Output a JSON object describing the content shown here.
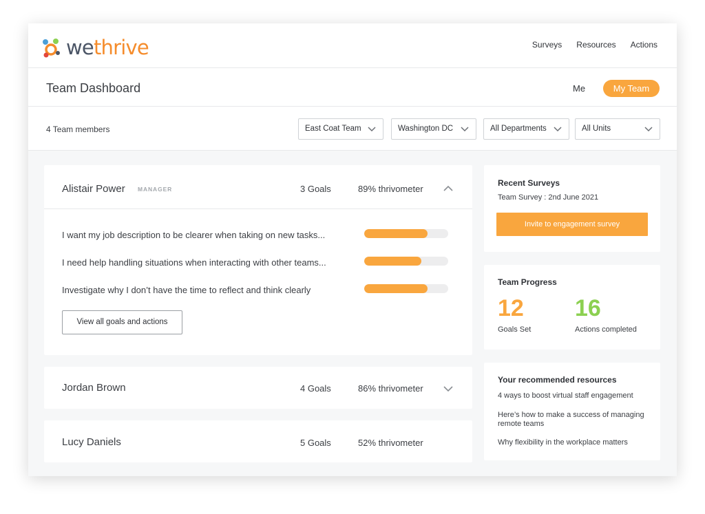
{
  "brand": {
    "name_part1": "we",
    "name_part2": "thrive",
    "accent": "#f9a63e",
    "logo_orange": "#f58c2c",
    "logo_blue": "#4b5566"
  },
  "nav": {
    "items": [
      {
        "label": "Surveys"
      },
      {
        "label": "Resources"
      },
      {
        "label": "Actions"
      }
    ]
  },
  "header": {
    "title": "Team Dashboard",
    "tabs": [
      {
        "label": "Me"
      },
      {
        "label": "My Team",
        "active": true
      }
    ]
  },
  "filters": {
    "member_count": "4 Team members",
    "selects": [
      {
        "value": "East Coat Team"
      },
      {
        "value": "Washington DC"
      },
      {
        "value": "All Departments"
      },
      {
        "value": "All Units"
      }
    ]
  },
  "members": [
    {
      "name": "Alistair Power",
      "role": "MANAGER",
      "goals": "3 Goals",
      "thrivometer": "89% thrivometer",
      "expanded": true,
      "goal_items": [
        {
          "text": "I want my job description to be clearer when taking on new tasks...",
          "progress": 0.75
        },
        {
          "text": "I need help handling situations when interacting with other teams...",
          "progress": 0.68
        },
        {
          "text": "Investigate why I don’t have the time to reflect and think clearly",
          "progress": 0.75
        }
      ],
      "view_all_label": "View all goals and actions"
    },
    {
      "name": "Jordan Brown",
      "goals": "4 Goals",
      "thrivometer": "86% thrivometer",
      "expanded": false
    },
    {
      "name": "Lucy Daniels",
      "goals": "5 Goals",
      "thrivometer": "52% thrivometer",
      "expanded": false
    }
  ],
  "recent_surveys": {
    "title": "Recent Surveys",
    "survey": "Team Survey : 2nd June 2021",
    "invite_label": "Invite to engagement survey"
  },
  "team_progress": {
    "title": "Team Progress",
    "goals_set": {
      "value": "12",
      "label": "Goals Set",
      "color": "#f9a63e"
    },
    "actions_completed": {
      "value": "16",
      "label": "Actions completed",
      "color": "#8cd051"
    }
  },
  "resources": {
    "title": "Your recommended resources",
    "items": [
      {
        "label": "4 ways to boost virtual staff engagement"
      },
      {
        "label": "Here’s how to make a success of managing remote teams"
      },
      {
        "label": "Why flexibility in the workplace matters"
      }
    ]
  }
}
